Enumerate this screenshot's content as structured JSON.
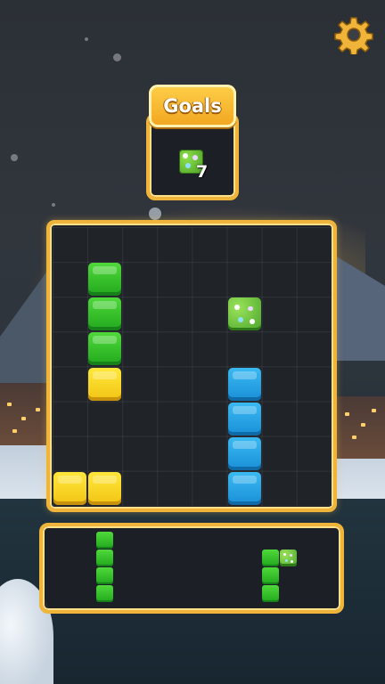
{
  "header": {
    "settings_icon": "gear-icon",
    "settings_color": "#f0b43a"
  },
  "goals": {
    "title": "Goals",
    "item_icon": "flower-tile-icon",
    "count": "7"
  },
  "board": {
    "rows": 8,
    "cols": 8,
    "tiles": [
      {
        "row": 1,
        "col": 1,
        "color": "green"
      },
      {
        "row": 2,
        "col": 1,
        "color": "green"
      },
      {
        "row": 3,
        "col": 1,
        "color": "green"
      },
      {
        "row": 4,
        "col": 1,
        "color": "yellow"
      },
      {
        "row": 2,
        "col": 5,
        "color": "flower"
      },
      {
        "row": 4,
        "col": 5,
        "color": "blue"
      },
      {
        "row": 5,
        "col": 5,
        "color": "blue"
      },
      {
        "row": 6,
        "col": 5,
        "color": "blue"
      },
      {
        "row": 7,
        "col": 5,
        "color": "blue"
      },
      {
        "row": 7,
        "col": 0,
        "color": "yellow"
      },
      {
        "row": 7,
        "col": 1,
        "color": "yellow"
      }
    ]
  },
  "tray": {
    "pieces": [
      {
        "name": "green-vertical-4-piece",
        "cells": [
          [
            0,
            0,
            "green"
          ],
          [
            1,
            0,
            "green"
          ],
          [
            2,
            0,
            "green"
          ],
          [
            3,
            0,
            "green"
          ]
        ]
      },
      {
        "name": "green-l-piece-with-flower",
        "cells": [
          [
            0,
            0,
            "green"
          ],
          [
            0,
            1,
            "flower"
          ],
          [
            1,
            0,
            "green"
          ],
          [
            2,
            0,
            "green"
          ]
        ]
      }
    ]
  },
  "colors": {
    "frame": "#f0b43a",
    "green": "#22a81d",
    "yellow": "#f2c414",
    "blue": "#1a8fd8"
  }
}
